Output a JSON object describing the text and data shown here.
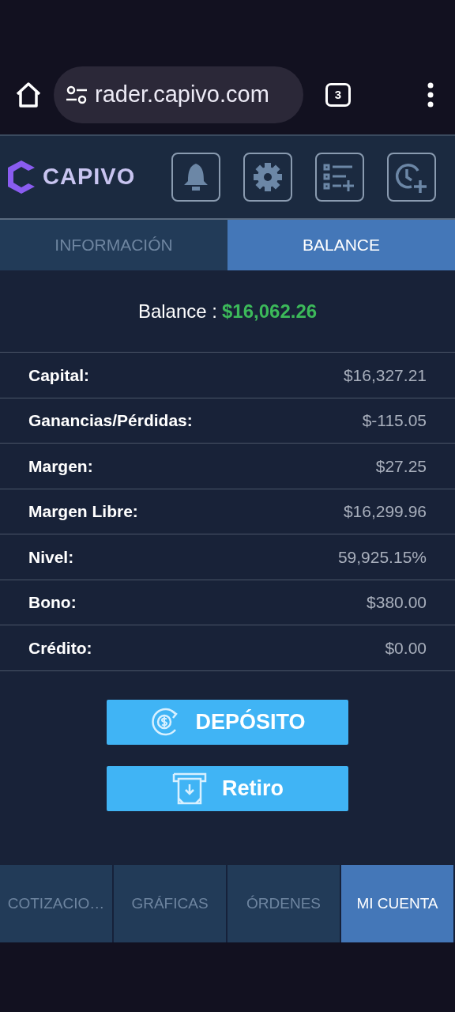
{
  "browser": {
    "url": "rader.capivo.com",
    "tab_count": "3"
  },
  "header": {
    "logo_text": "CAPIVO"
  },
  "tabs": [
    {
      "label": "INFORMACIÓN",
      "selected": false
    },
    {
      "label": "BALANCE",
      "selected": true
    }
  ],
  "balance": {
    "label": "Balance :",
    "value": "$16,062.26"
  },
  "rows": [
    {
      "label": "Capital:",
      "value": "$16,327.21"
    },
    {
      "label": "Ganancias/Pérdidas:",
      "value": "$-115.05"
    },
    {
      "label": "Margen:",
      "value": "$27.25"
    },
    {
      "label": "Margen Libre:",
      "value": "$16,299.96"
    },
    {
      "label": "Nivel:",
      "value": "59,925.15%"
    },
    {
      "label": "Bono:",
      "value": "$380.00"
    },
    {
      "label": "Crédito:",
      "value": "$0.00"
    }
  ],
  "buttons": [
    {
      "label": "DEPÓSITO",
      "kind": "deposit"
    },
    {
      "label": "Retiro",
      "kind": "withdraw"
    }
  ],
  "bottom_nav": [
    {
      "label": "COTIZACIO…",
      "selected": false
    },
    {
      "label": "GRÁFICAS",
      "selected": false
    },
    {
      "label": "ÓRDENES",
      "selected": false
    },
    {
      "label": "MI CUENTA",
      "selected": true
    }
  ]
}
